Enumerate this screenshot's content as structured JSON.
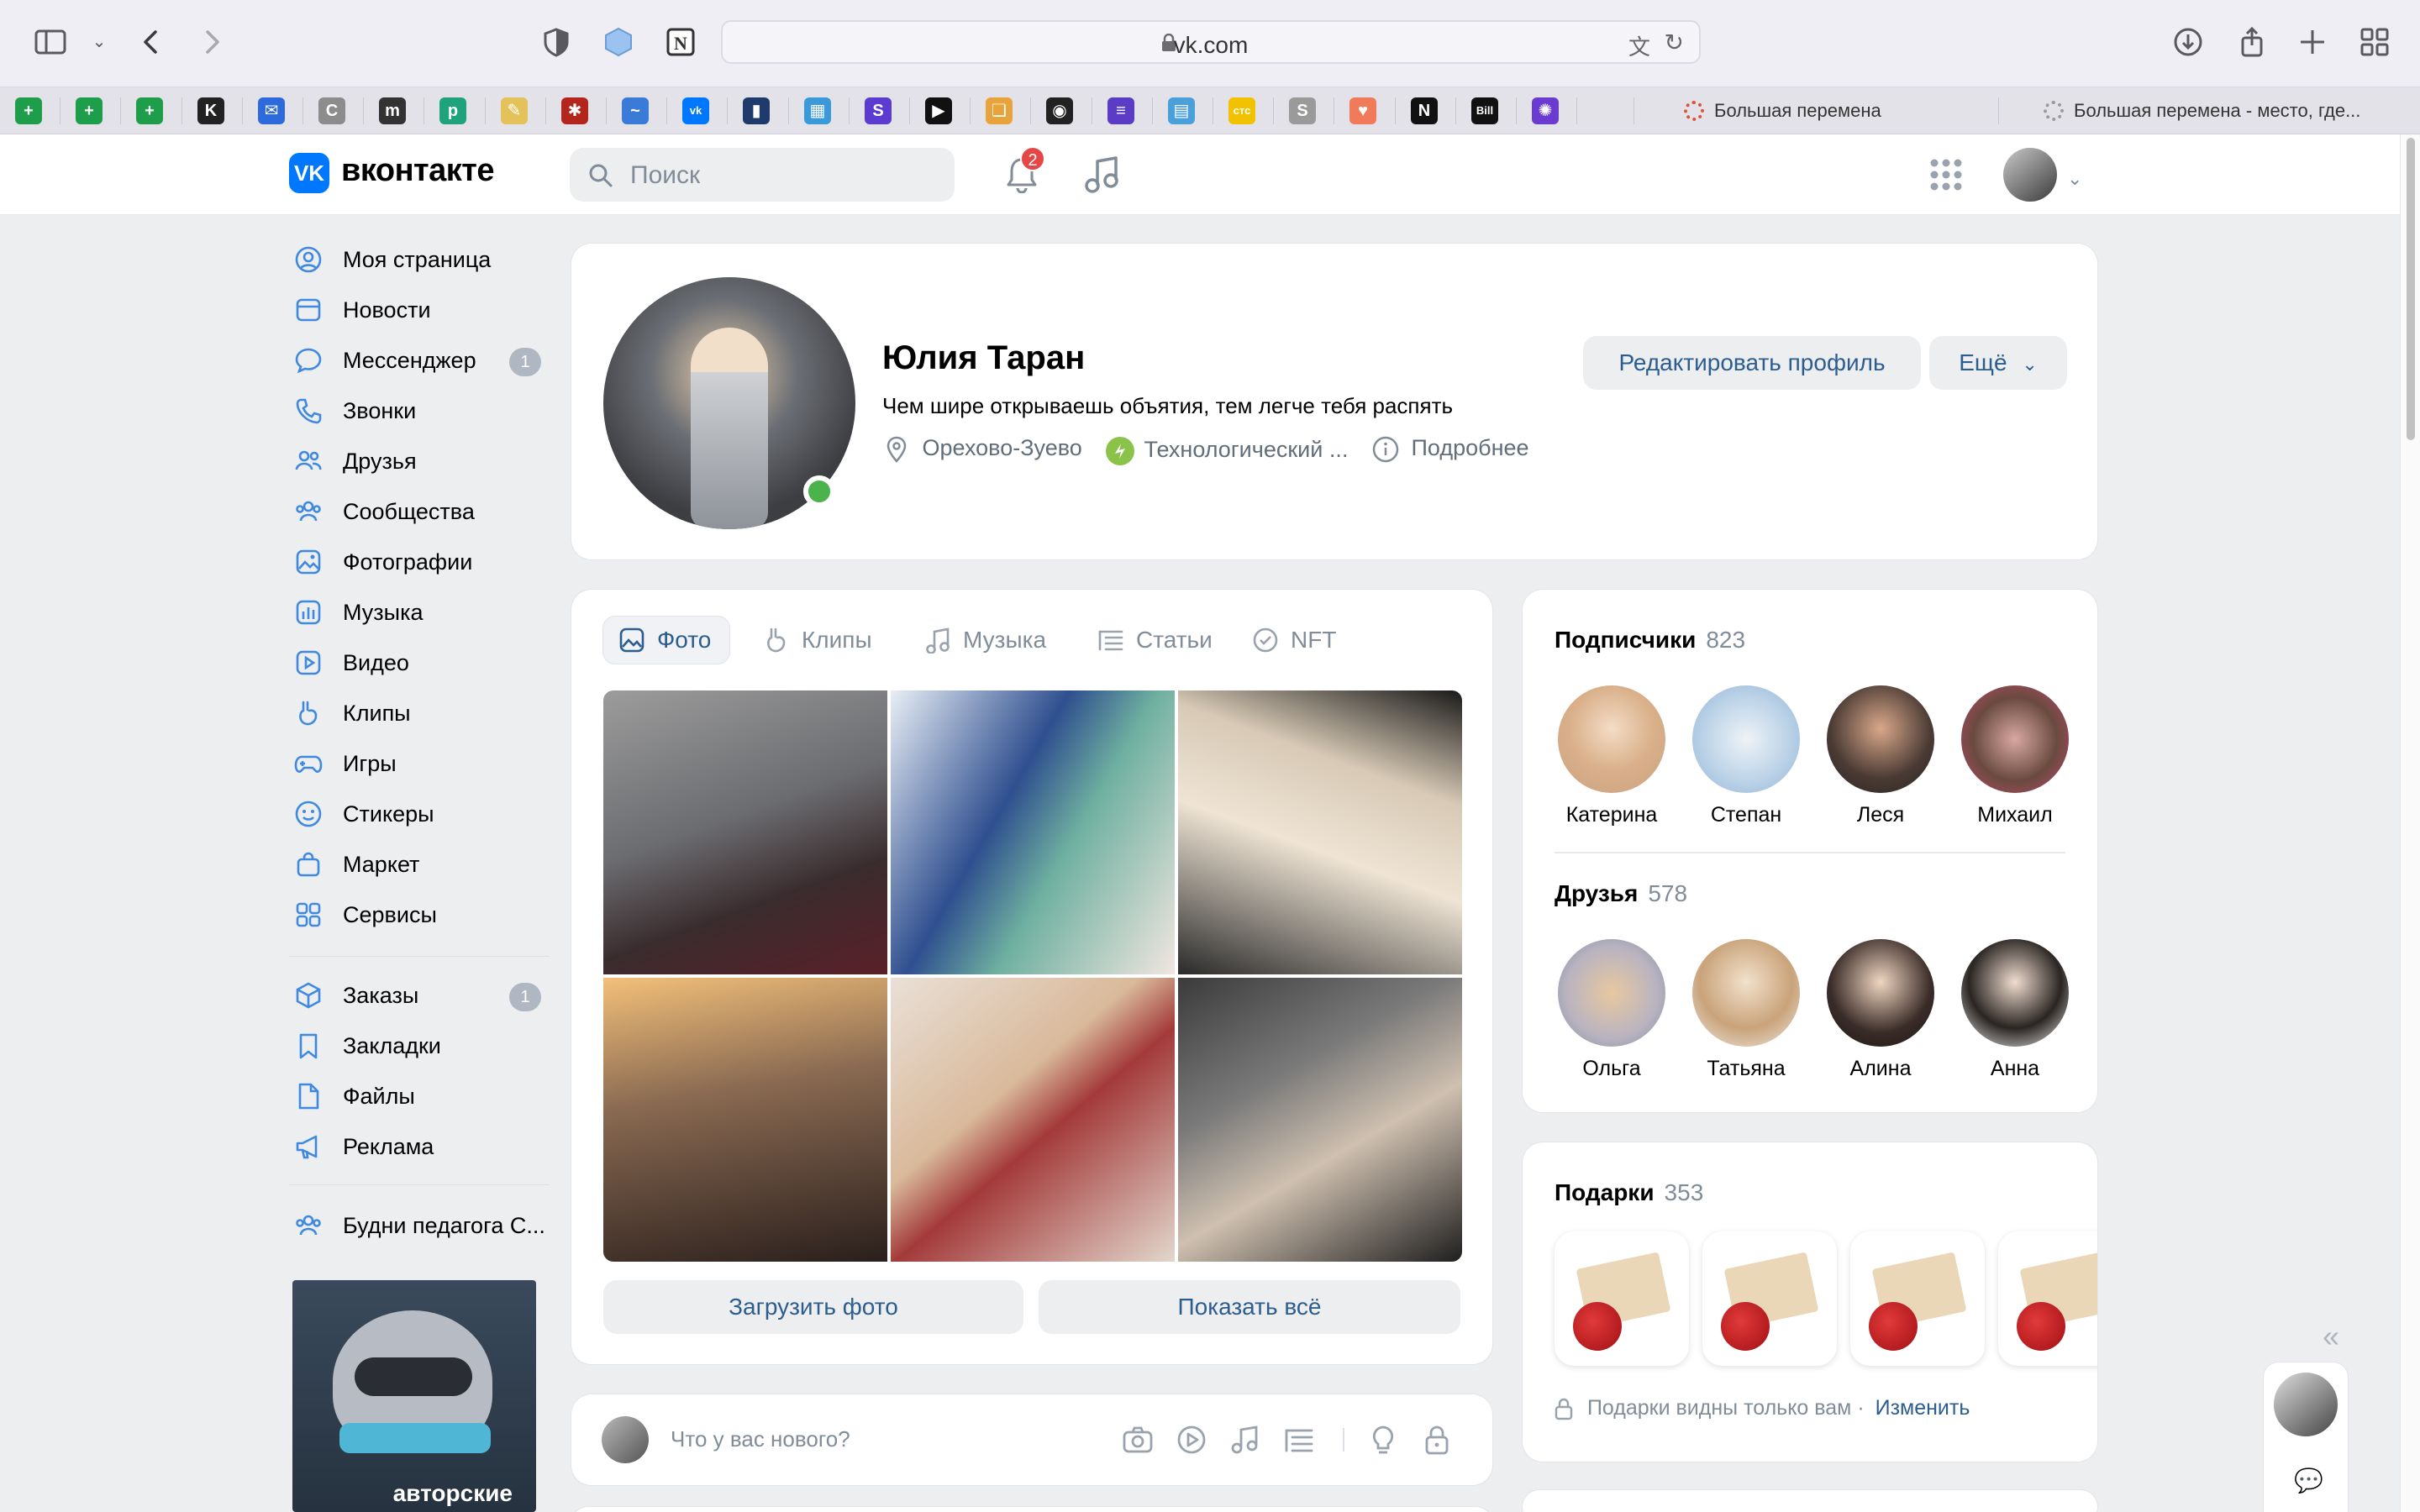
{
  "browser": {
    "url": "vk.com",
    "tabs": [
      {
        "title": "Большая перемена"
      },
      {
        "title": "Большая перемена - место, где..."
      }
    ],
    "favorites": [
      {
        "icon": "sheets-icon",
        "color": "#1e9e4a",
        "glyph": "+"
      },
      {
        "icon": "sheets-icon",
        "color": "#1e9e4a",
        "glyph": "+"
      },
      {
        "icon": "sheets-icon",
        "color": "#1e9e4a",
        "glyph": "+"
      },
      {
        "icon": "kinopoisk-icon",
        "color": "#222222",
        "glyph": "K"
      },
      {
        "icon": "mail-icon",
        "color": "#2d6bdc",
        "glyph": "✉"
      },
      {
        "icon": "c-icon",
        "color": "#8c8c8c",
        "glyph": "C"
      },
      {
        "icon": "m-icon",
        "color": "#333333",
        "glyph": "m"
      },
      {
        "icon": "p-icon",
        "color": "#1ea37a",
        "glyph": "p"
      },
      {
        "icon": "brush-icon",
        "color": "#e4c25a",
        "glyph": "✎"
      },
      {
        "icon": "ornament-icon",
        "color": "#b3261e",
        "glyph": "✱"
      },
      {
        "icon": "swirl-icon",
        "color": "#3b7bd8",
        "glyph": "~"
      },
      {
        "icon": "vk-icon",
        "color": "#0077ff",
        "glyph": "vk"
      },
      {
        "icon": "book-icon",
        "color": "#1f3b6b",
        "glyph": "▮"
      },
      {
        "icon": "blocks-icon",
        "color": "#3a9ad9",
        "glyph": "▦"
      },
      {
        "icon": "s-icon",
        "color": "#5b3bd1",
        "glyph": "S"
      },
      {
        "icon": "play-icon",
        "color": "#111111",
        "glyph": "▶"
      },
      {
        "icon": "book-open-icon",
        "color": "#e8a43a",
        "glyph": "❏"
      },
      {
        "icon": "owl-icon",
        "color": "#222222",
        "glyph": "◉"
      },
      {
        "icon": "list-icon",
        "color": "#5a3cc6",
        "glyph": "≡"
      },
      {
        "icon": "map-icon",
        "color": "#4aa0d8",
        "glyph": "▤"
      },
      {
        "icon": "ctc-icon",
        "color": "#f2c200",
        "glyph": "стс"
      },
      {
        "icon": "s-grey-icon",
        "color": "#9a9a9a",
        "glyph": "S"
      },
      {
        "icon": "heart-icon",
        "color": "#f07a5a",
        "glyph": "♥"
      },
      {
        "icon": "notion-icon",
        "color": "#111111",
        "glyph": "N"
      },
      {
        "icon": "bill-icon",
        "color": "#111111",
        "glyph": "Bill"
      },
      {
        "icon": "atom-icon",
        "color": "#6b3bd1",
        "glyph": "✺"
      }
    ]
  },
  "header": {
    "logo_text": "вконтакте",
    "search_placeholder": "Поиск",
    "notifications_count": "2"
  },
  "nav": {
    "items": [
      {
        "label": "Моя страница",
        "icon": "user-circle-icon"
      },
      {
        "label": "Новости",
        "icon": "news-icon"
      },
      {
        "label": "Мессенджер",
        "icon": "message-icon",
        "count": "1"
      },
      {
        "label": "Звонки",
        "icon": "phone-icon"
      },
      {
        "label": "Друзья",
        "icon": "friends-icon"
      },
      {
        "label": "Сообщества",
        "icon": "communities-icon"
      },
      {
        "label": "Фотографии",
        "icon": "photo-icon"
      },
      {
        "label": "Музыка",
        "icon": "music-icon"
      },
      {
        "label": "Видео",
        "icon": "video-icon"
      },
      {
        "label": "Клипы",
        "icon": "clips-icon"
      },
      {
        "label": "Игры",
        "icon": "gamepad-icon"
      },
      {
        "label": "Стикеры",
        "icon": "smile-icon"
      },
      {
        "label": "Маркет",
        "icon": "bag-icon"
      },
      {
        "label": "Сервисы",
        "icon": "services-icon"
      }
    ],
    "items2": [
      {
        "label": "Заказы",
        "icon": "box-icon",
        "count": "1"
      },
      {
        "label": "Закладки",
        "icon": "bookmark-icon"
      },
      {
        "label": "Файлы",
        "icon": "file-icon"
      },
      {
        "label": "Реклама",
        "icon": "megaphone-icon"
      }
    ],
    "group": {
      "label": "Будни педагога С...",
      "icon": "group-icon"
    },
    "promo_text": "авторские"
  },
  "profile": {
    "name": "Юлия Таран",
    "status": "Чем шире открываешь объятия, тем легче тебя распять",
    "city": "Орехово-Зуево",
    "university": "Технологический ...",
    "more": "Подробнее",
    "edit_button": "Редактировать профиль",
    "more_button": "Ещё"
  },
  "media": {
    "tabs": [
      "Фото",
      "Клипы",
      "Музыка",
      "Статьи",
      "NFT"
    ],
    "active_tab": "Фото",
    "upload_button": "Загрузить фото",
    "show_all_button": "Показать всё"
  },
  "followers": {
    "title": "Подписчики",
    "count": "823",
    "people": [
      "Катерина",
      "Степан",
      "Леся",
      "Михаил"
    ]
  },
  "friends": {
    "title": "Друзья",
    "count": "578",
    "people": [
      "Ольга",
      "Татьяна",
      "Алина",
      "Анна"
    ]
  },
  "gifts": {
    "title": "Подарки",
    "count": "353",
    "note": "Подарки видны только вам ·",
    "change_link": "Изменить"
  },
  "post": {
    "placeholder": "Что у вас нового?"
  },
  "colors": {
    "accent": "#0077ff",
    "link": "#2c5d8f",
    "online": "#4bb34b",
    "badge": "#e64646"
  }
}
